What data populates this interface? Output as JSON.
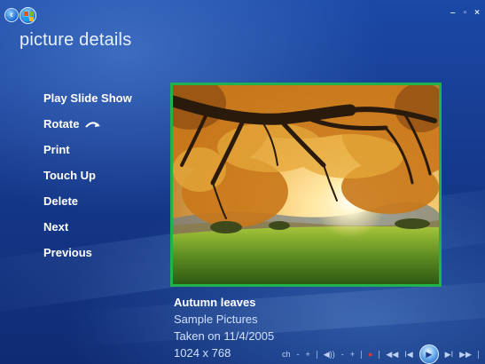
{
  "window": {
    "controls": [
      "–",
      "▫",
      "×"
    ]
  },
  "header": {
    "title": "picture details"
  },
  "menu": {
    "items": [
      {
        "label": "Play Slide Show"
      },
      {
        "label": "Rotate"
      },
      {
        "label": "Print"
      },
      {
        "label": "Touch Up"
      },
      {
        "label": "Delete"
      },
      {
        "label": "Next"
      },
      {
        "label": "Previous"
      }
    ]
  },
  "picture": {
    "title": "Autumn leaves",
    "album": "Sample Pictures",
    "taken": "Taken on 11/4/2005",
    "dimensions": "1024 x 768"
  },
  "transport": {
    "ch": "ch",
    "minus1": "-",
    "plus1": "+",
    "vol": "◀))",
    "minus2": "-",
    "plus2": "+",
    "rec": "●",
    "prev_skip": "◀◀",
    "prev": "I◀",
    "play": "▶",
    "next": "▶I",
    "next_skip": "▶▶",
    "stop": "■"
  },
  "colors": {
    "background_top": "#1b49a6",
    "background_bottom": "#0f2b73",
    "frame_border": "#21b24b",
    "caption_meta": "#cfe0ff"
  }
}
